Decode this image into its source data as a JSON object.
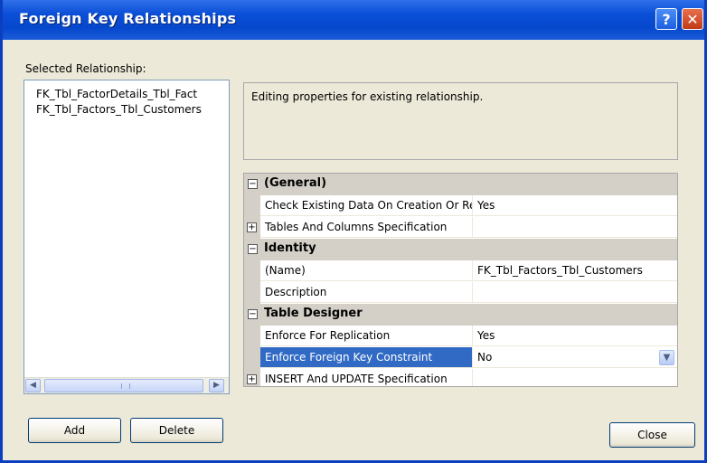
{
  "window": {
    "title": "Foreign Key Relationships"
  },
  "left_panel": {
    "label": "Selected Relationship:",
    "items": [
      "FK_Tbl_FactorDetails_Tbl_Fact",
      "FK_Tbl_Factors_Tbl_Customers"
    ],
    "scroll_left": "◀",
    "scroll_right": "▶"
  },
  "description": "Editing properties for existing relationship.",
  "properties": {
    "general": {
      "label": "(General)",
      "toggle": "−",
      "check_existing": {
        "name": "Check Existing Data On Creation Or Re-Enabling",
        "value": "Yes"
      },
      "tables_columns": {
        "name": "Tables And Columns Specification",
        "value": "",
        "expander": "+"
      }
    },
    "identity": {
      "label": "Identity",
      "toggle": "−",
      "name_prop": {
        "name": "(Name)",
        "value": "FK_Tbl_Factors_Tbl_Customers"
      },
      "description_prop": {
        "name": "Description",
        "value": ""
      }
    },
    "table_designer": {
      "label": "Table Designer",
      "toggle": "−",
      "enforce_replication": {
        "name": "Enforce For Replication",
        "value": "Yes"
      },
      "enforce_fk": {
        "name": "Enforce Foreign Key Constraint",
        "value": "No",
        "dropdown": "▼"
      },
      "insert_update": {
        "name": "INSERT And UPDATE Specification",
        "value": "",
        "expander": "+"
      }
    }
  },
  "buttons": {
    "add": "Add",
    "delete": "Delete",
    "close": "Close"
  },
  "title_buttons": {
    "help": "?",
    "close": "✕"
  }
}
